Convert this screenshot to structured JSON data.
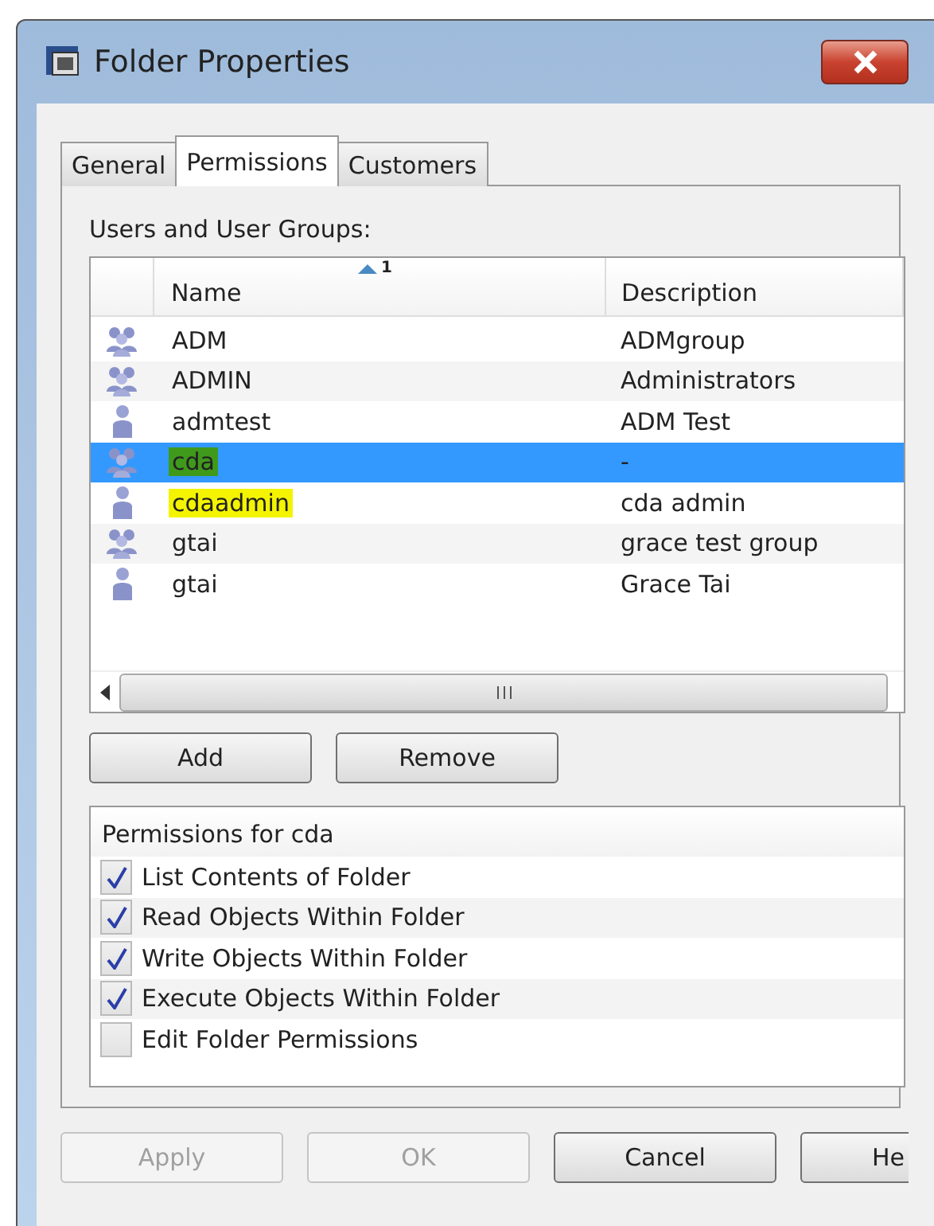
{
  "window": {
    "title": "Folder Properties"
  },
  "tabs": [
    {
      "label": "General",
      "selected": false
    },
    {
      "label": "Permissions",
      "selected": true
    },
    {
      "label": "Customers",
      "selected": false
    }
  ],
  "users_label": "Users and User Groups:",
  "table": {
    "sort_order": "1",
    "columns": [
      "Name",
      "Description"
    ],
    "rows": [
      {
        "kind": "group",
        "name": "ADM",
        "description": "ADMgroup",
        "selected": false
      },
      {
        "kind": "group",
        "name": "ADMIN",
        "description": "Administrators",
        "selected": false
      },
      {
        "kind": "user",
        "name": "admtest",
        "description": "ADM Test",
        "selected": false
      },
      {
        "kind": "group",
        "name": "cda",
        "description": "-",
        "selected": true,
        "color": "#3f9a1c"
      },
      {
        "kind": "user",
        "name": "cdaadmin",
        "description": "cda admin",
        "selected": false,
        "color": "#f4f400"
      },
      {
        "kind": "group",
        "name": "gtai",
        "description": "grace test group",
        "selected": false
      },
      {
        "kind": "user",
        "name": "gtai",
        "description": "Grace Tai",
        "selected": false
      }
    ]
  },
  "list_buttons": [
    "Add",
    "Remove"
  ],
  "permissions": {
    "title": "Permissions for cda",
    "items": [
      {
        "label": "List Contents of Folder",
        "checked": true
      },
      {
        "label": "Read Objects Within Folder",
        "checked": true
      },
      {
        "label": "Write Objects Within Folder",
        "checked": true
      },
      {
        "label": "Execute Objects Within Folder",
        "checked": true
      },
      {
        "label": "Edit Folder Permissions",
        "checked": false
      }
    ]
  },
  "footer_buttons": [
    {
      "label": "Apply",
      "disabled": true
    },
    {
      "label": "OK",
      "disabled": true
    },
    {
      "label": "Cancel",
      "disabled": false
    },
    {
      "label": "He",
      "disabled": false
    }
  ]
}
